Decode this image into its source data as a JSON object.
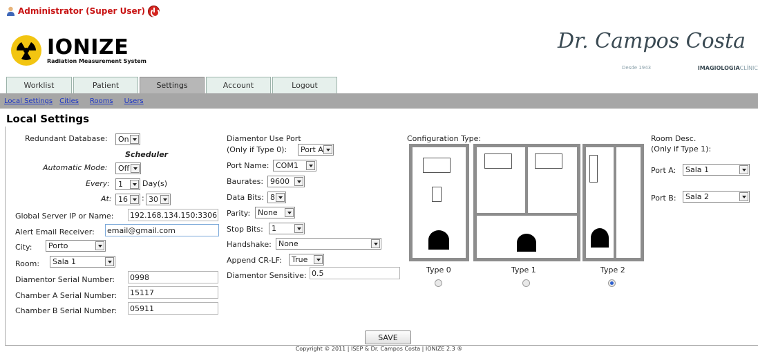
{
  "user": {
    "name": "Administrator (Super User)"
  },
  "logo": {
    "name": "IONIZE",
    "subtitle": "Radiation Measurement System"
  },
  "partner": {
    "signature": "Dr. Campos Costa",
    "since": "Desde 1943",
    "clinic_bold": "IMAGIOLOGIA",
    "clinic_rest": "CLÍNIC"
  },
  "tabs": [
    "Worklist",
    "Patient",
    "Settings",
    "Account",
    "Logout"
  ],
  "active_tab": "Settings",
  "subnav": [
    "Local Settings",
    "Cities",
    "Rooms",
    "Users"
  ],
  "page_title": "Local Settings",
  "left": {
    "redundant_label": "Redundant Database:",
    "redundant_value": "On",
    "scheduler_title": "Scheduler",
    "auto_label": "Automatic Mode:",
    "auto_value": "Off",
    "every_label": "Every:",
    "every_value": "1",
    "every_unit": "Day(s)",
    "at_label": "At:",
    "at_hour": "16",
    "at_sep": ":",
    "at_min": "30",
    "server_label": "Global Server IP or Name:",
    "server_value": "192.168.134.150:3306",
    "email_label": "Alert Email Receiver:",
    "email_value": "email@gmail.com",
    "city_label": "City:",
    "city_value": "Porto",
    "room_label": "Room:",
    "room_value": "Sala 1",
    "diamentor_sn_label": "Diamentor Serial Number:",
    "diamentor_sn_value": "0998",
    "chamber_a_label": "Chamber A Serial Number:",
    "chamber_a_value": "15117",
    "chamber_b_label": "Chamber B Serial Number:",
    "chamber_b_value": "05911"
  },
  "middle": {
    "use_port_label_1": "Diamentor Use Port",
    "use_port_label_2": "(Only if Type 0):",
    "use_port_value": "Port A",
    "port_name_label": "Port Name:",
    "port_name_value": "COM1",
    "baud_label": "Baurates:",
    "baud_value": "9600",
    "data_bits_label": "Data Bits:",
    "data_bits_value": "8",
    "parity_label": "Parity:",
    "parity_value": "None",
    "stop_bits_label": "Stop Bits:",
    "stop_bits_value": "1",
    "handshake_label": "Handshake:",
    "handshake_value": "None",
    "crlf_label": "Append CR-LF:",
    "crlf_value": "True",
    "sensitive_label": "Diamentor Sensitive:",
    "sensitive_value": "0.5"
  },
  "config": {
    "label": "Configuration Type:",
    "types": [
      "Type 0",
      "Type 1",
      "Type 2"
    ],
    "selected": "Type 2"
  },
  "room_desc": {
    "label_1": "Room Desc.",
    "label_2": "(Only if Type 1):",
    "port_a_label": "Port A:",
    "port_a_value": "Sala 1",
    "port_b_label": "Port B:",
    "port_b_value": "Sala 2"
  },
  "save_label": "SAVE",
  "copyright": "Copyright © 2011 | ISEP & Dr. Campos Costa | IONIZE 2.3 ®",
  "colors": {
    "user": "#c81414",
    "link": "#1a33c4",
    "subbar": "#a6a6a6",
    "tab": "#e6f0ec",
    "tab_active": "#b7b7b7"
  }
}
